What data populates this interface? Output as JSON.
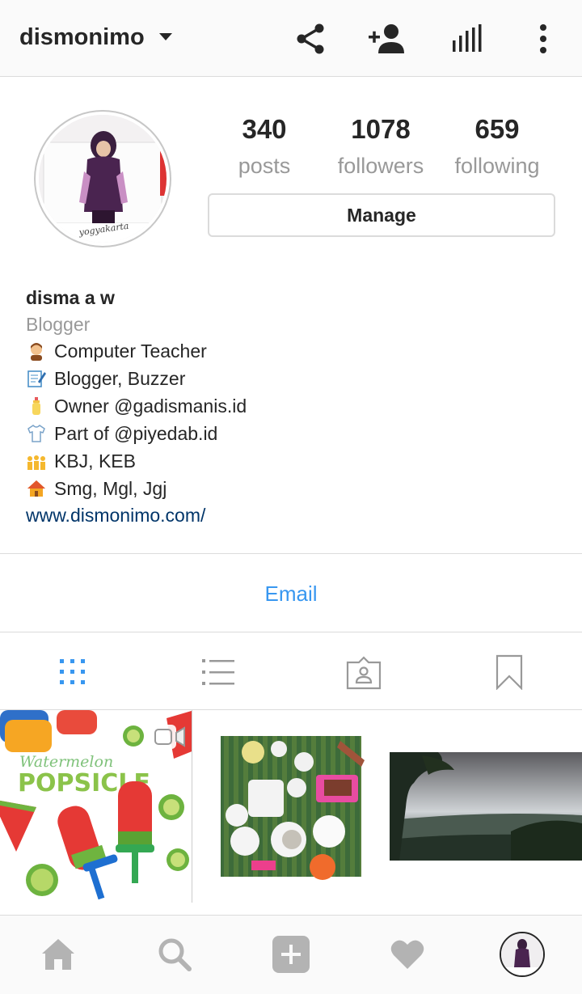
{
  "header": {
    "username": "dismonimo"
  },
  "profile": {
    "stats": [
      {
        "value": "340",
        "label": "posts"
      },
      {
        "value": "1078",
        "label": "followers"
      },
      {
        "value": "659",
        "label": "following"
      }
    ],
    "manage_label": "Manage",
    "avatar_caption": "yogyakarta"
  },
  "bio": {
    "name": "disma a w",
    "category": "Blogger",
    "lines": [
      {
        "icon": "teacher-emoji",
        "text": "Computer Teacher"
      },
      {
        "icon": "memo-emoji",
        "text": "Blogger, Buzzer"
      },
      {
        "icon": "baby-bottle-emoji",
        "text": "Owner @gadismanis.id"
      },
      {
        "icon": "tshirt-emoji",
        "text": "Part of @piyedab.id"
      },
      {
        "icon": "family-emoji",
        "text": "KBJ, KEB"
      },
      {
        "icon": "house-emoji",
        "text": "Smg, Mgl, Jgj"
      }
    ],
    "website": "www.dismonimo.com/"
  },
  "contact": {
    "email_label": "Email"
  },
  "posts": [
    {
      "title_line1": "Watermelon",
      "title_line2": "POPSICLE",
      "type": "video"
    },
    {
      "type": "photo"
    },
    {
      "type": "photo"
    }
  ],
  "colors": {
    "accent": "#3897f0",
    "link": "#003569",
    "muted": "#999999",
    "border": "#dbdbdb"
  }
}
